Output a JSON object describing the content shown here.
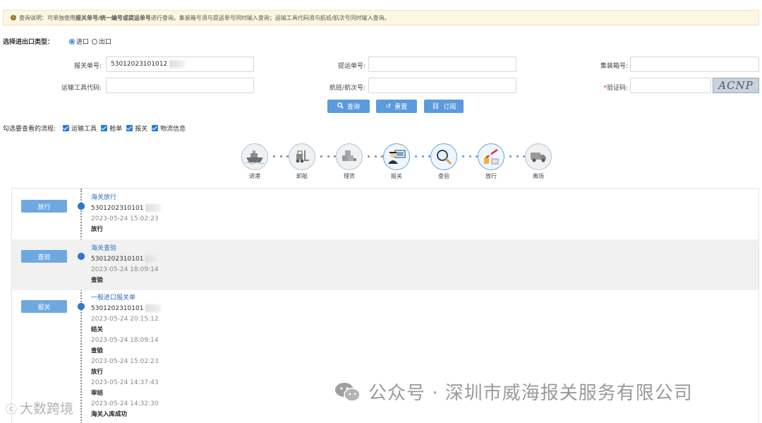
{
  "notice": {
    "prefix": "查询说明：可单独使用",
    "bold1": "报关单号/统一编号或提运单号",
    "suffix": "进行查询。集装箱号须与提运单号同时输入查询；运输工具代码须与航班/航次号同时输入查询。"
  },
  "io_type": {
    "label": "选择进出口类型：",
    "options": [
      "进口",
      "出口"
    ],
    "selected": "进口"
  },
  "fields": {
    "declaration_no": {
      "label": "报关单号:",
      "value": "53012023101012"
    },
    "bill_no": {
      "label": "提运单号:",
      "value": ""
    },
    "container_no": {
      "label": "集装箱号:",
      "value": ""
    },
    "transport_code": {
      "label": "运输工具代码:",
      "value": ""
    },
    "voyage_no": {
      "label": "航班/航次号:",
      "value": ""
    },
    "captcha": {
      "label": "验证码:",
      "required_mark": "*",
      "value": "",
      "image_text": "ACNP"
    }
  },
  "buttons": {
    "query": "查询",
    "reset": "重置",
    "subscribe": "订阅"
  },
  "process_select": {
    "label": "勾选要查看的流程:",
    "options": [
      "运输工具",
      "舱单",
      "报关",
      "物流信息"
    ]
  },
  "flow": {
    "nodes": [
      {
        "label": "进港",
        "icon": "ship-icon"
      },
      {
        "label": "卸船",
        "icon": "forklift-icon"
      },
      {
        "label": "理货",
        "icon": "cargo-boxes-icon"
      },
      {
        "label": "报关",
        "icon": "customs-officer-icon"
      },
      {
        "label": "查验",
        "icon": "magnifier-icon"
      },
      {
        "label": "放行",
        "icon": "gate-barrier-icon"
      },
      {
        "label": "离场",
        "icon": "truck-icon"
      }
    ]
  },
  "timeline": [
    {
      "button": "放行",
      "title": "海关放行",
      "id": "5301202310101",
      "events": [
        {
          "time": "2023-05-24 15:02:23",
          "status": "放行"
        }
      ]
    },
    {
      "button": "查验",
      "title": "海关查验",
      "id": "5301202310101",
      "events": [
        {
          "time": "2023-05-24 18:09:14",
          "status": "查验"
        }
      ]
    },
    {
      "button": "报关",
      "title": "一般进口报关单",
      "id": "5301202310101",
      "events": [
        {
          "time": "2023-05-24 20:15:12",
          "status": "结关"
        },
        {
          "time": "2023-05-24 18:09:14",
          "status": "查验"
        },
        {
          "time": "2023-05-24 15:02:23",
          "status": "放行"
        },
        {
          "time": "2023-05-24 14:37:43",
          "status": "审结"
        },
        {
          "time": "2023-05-24 14:32:30",
          "status": "海关入库成功"
        }
      ]
    }
  ],
  "watermark": {
    "main": "公众号 · 深圳市威海报关服务有限公司",
    "corner": "大数跨境"
  }
}
